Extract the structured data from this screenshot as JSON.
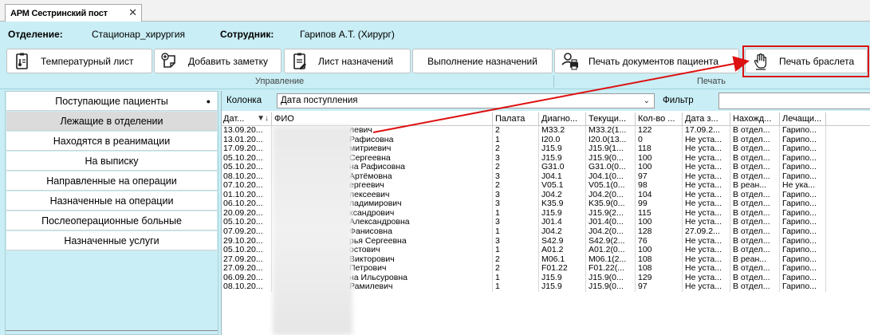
{
  "tab": {
    "title": "АРМ Сестринский пост",
    "close": "✕"
  },
  "info": {
    "department_label": "Отделение:",
    "department_value": "Стационар_хирургия",
    "employee_label": "Сотрудник:",
    "employee_value": "Гарипов А.Т. (Хирург)"
  },
  "toolbar": {
    "temp_sheet": "Температурный лист",
    "add_note": "Добавить заметку",
    "prescriptions_sheet": "Лист назначений",
    "execute_prescriptions": "Выполнение назначений",
    "print_patient_docs": "Печать документов пациента",
    "print_bracelet": "Печать браслета",
    "group_manage": "Управление",
    "group_print": "Печать"
  },
  "nav": {
    "items": [
      "Поступающие пациенты",
      "Лежащие в отделении",
      "Находятся в реанимации",
      "На выписку",
      "Направленные на операции",
      "Назначенные на операции",
      "Послеоперационные больные",
      "Назначенные услуги"
    ],
    "dot": "●"
  },
  "filter": {
    "column_label": "Колонка",
    "column_value": "Дата поступления",
    "filter_label": "Фильтр",
    "chevron": "⌄"
  },
  "table": {
    "headers": [
      "Дат...",
      "ФИО",
      "Палата",
      "Диагно...",
      "Текущи...",
      "Кол-во ...",
      "Дата з...",
      "Нахожд...",
      "Лечащи..."
    ],
    "sort_icon": "▼↓",
    "rows": [
      [
        "13.09.20...",
        "левич",
        "2",
        "M33.2",
        "M33.2(1...",
        "122",
        "17.09.2...",
        "В отдел...",
        "Гарипо..."
      ],
      [
        "13.01.20...",
        "Рафисовна",
        "1",
        "I20.0",
        "I20.0(13...",
        "0",
        "Не уста...",
        "В отдел...",
        "Гарипо..."
      ],
      [
        "17.09.20...",
        "митриевич",
        "2",
        "J15.9",
        "J15.9(1...",
        "118",
        "Не уста...",
        "В отдел...",
        "Гарипо..."
      ],
      [
        "05.10.20...",
        "Сергеевна",
        "3",
        "J15.9",
        "J15.9(0...",
        "100",
        "Не уста...",
        "В отдел...",
        "Гарипо..."
      ],
      [
        "05.10.20...",
        "на Рафисовна",
        "2",
        "G31.0",
        "G31.0(0...",
        "100",
        "Не уста...",
        "В отдел...",
        "Гарипо..."
      ],
      [
        "08.10.20...",
        "Артёмовна",
        "3",
        "J04.1",
        "J04.1(0...",
        "97",
        "Не уста...",
        "В отдел...",
        "Гарипо..."
      ],
      [
        "07.10.20...",
        "ергеевич",
        "2",
        "V05.1",
        "V05.1(0...",
        "98",
        "Не уста...",
        "В реан...",
        "Не ука..."
      ],
      [
        "01.10.20...",
        "лексеевич",
        "3",
        "J04.2",
        "J04.2(0...",
        "104",
        "Не уста...",
        "В отдел...",
        "Гарипо..."
      ],
      [
        "06.10.20...",
        "ладимирович",
        "3",
        "K35.9",
        "K35.9(0...",
        "99",
        "Не уста...",
        "В отдел...",
        "Гарипо..."
      ],
      [
        "20.09.20...",
        "ксандрович",
        "1",
        "J15.9",
        "J15.9(2...",
        "115",
        "Не уста...",
        "В отдел...",
        "Гарипо..."
      ],
      [
        "05.10.20...",
        "Александровна",
        "3",
        "J01.4",
        "J01.4(0...",
        "100",
        "Не уста...",
        "В отдел...",
        "Гарипо..."
      ],
      [
        "07.09.20...",
        "Фанисовна",
        "1",
        "J04.2",
        "J04.2(0...",
        "128",
        "27.09.2...",
        "В отдел...",
        "Гарипо..."
      ],
      [
        "29.10.20...",
        "рья Сергеевна",
        "3",
        "S42.9",
        "S42.9(2...",
        "76",
        "Не уста...",
        "В отдел...",
        "Гарипо..."
      ],
      [
        "05.10.20...",
        "остович",
        "1",
        "A01.2",
        "A01.2(0...",
        "100",
        "Не уста...",
        "В отдел...",
        "Гарипо..."
      ],
      [
        "27.09.20...",
        "Викторович",
        "2",
        "M06.1",
        "M06.1(2...",
        "108",
        "Не уста...",
        "В реан...",
        "Гарипо..."
      ],
      [
        "27.09.20...",
        "Петрович",
        "2",
        "F01.22",
        "F01.22(...",
        "108",
        "Не уста...",
        "В отдел...",
        "Гарипо..."
      ],
      [
        "06.09.20...",
        "на Ильсуровна",
        "1",
        "J15.9",
        "J15.9(0...",
        "129",
        "Не уста...",
        "В отдел...",
        "Гарипо..."
      ],
      [
        "08.10.20...",
        "Рамилевич",
        "1",
        "J15.9",
        "J15.9(0...",
        "97",
        "Не уста...",
        "В отдел...",
        "Гарипо..."
      ]
    ]
  },
  "colors": {
    "background": "#c9eef5",
    "highlight": "#d11111"
  },
  "icons": [
    "thermometer-document-icon",
    "add-note-icon",
    "prescription-list-icon",
    "print-documents-icon",
    "hand-icon",
    "sort-icon",
    "chevron-down-icon",
    "close-icon"
  ]
}
